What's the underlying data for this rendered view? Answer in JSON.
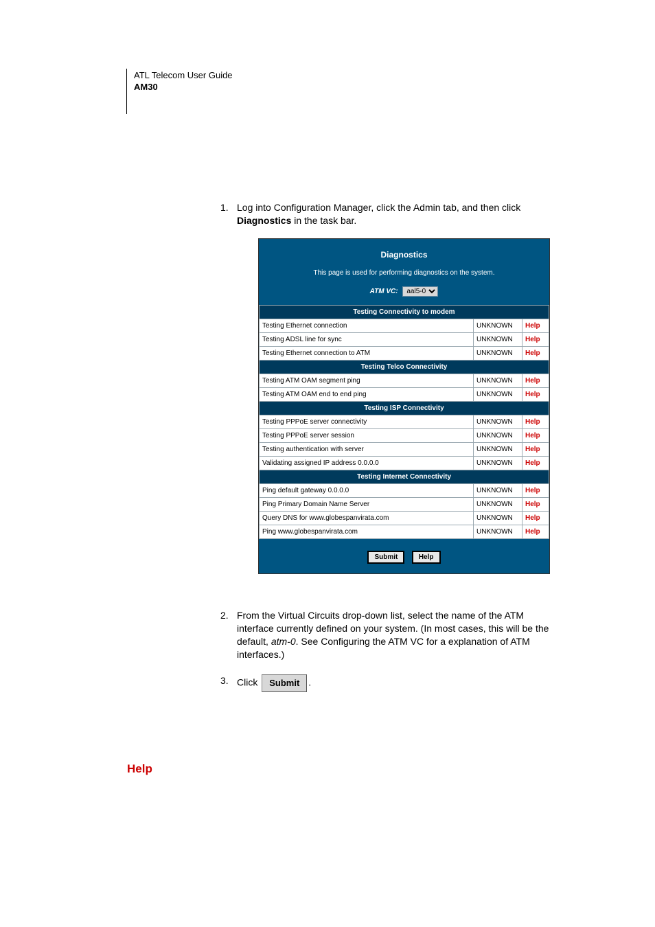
{
  "header": {
    "line1": "ATL Telecom User Guide",
    "line2": "AM30"
  },
  "steps": {
    "s1": {
      "num": "1.",
      "pre": "Log into Configuration Manager, click the Admin tab, and then click ",
      "bold": "Diagnostics",
      "post": " in the task bar."
    },
    "s2": {
      "num": "2.",
      "pre": "From the Virtual Circuits drop-down list, select the name of the ATM interface currently defined on your system. (In most cases, this will be the default, ",
      "italic": "atm-0",
      "post": ". See Configuring the ATM VC for a explanation of ATM interfaces.)"
    },
    "s3": {
      "num": "3.",
      "pre": "Click ",
      "btn": "Submit",
      "post": "."
    }
  },
  "panel": {
    "title": "Diagnostics",
    "desc": "This page is used for performing diagnostics on the system.",
    "atm_label": "ATM VC:",
    "atm_value": "aal5-0",
    "sections": [
      {
        "header": "Testing Connectivity to modem",
        "rows": [
          {
            "test": "Testing Ethernet connection",
            "status": "UNKNOWN",
            "help": "Help"
          },
          {
            "test": "Testing ADSL line for sync",
            "status": "UNKNOWN",
            "help": "Help"
          },
          {
            "test": "Testing Ethernet connection to ATM",
            "status": "UNKNOWN",
            "help": "Help"
          }
        ]
      },
      {
        "header": "Testing Telco Connectivity",
        "rows": [
          {
            "test": "Testing ATM OAM segment ping",
            "status": "UNKNOWN",
            "help": "Help"
          },
          {
            "test": "Testing ATM OAM end to end ping",
            "status": "UNKNOWN",
            "help": "Help"
          }
        ]
      },
      {
        "header": "Testing ISP Connectivity",
        "rows": [
          {
            "test": "Testing PPPoE server connectivity",
            "status": "UNKNOWN",
            "help": "Help"
          },
          {
            "test": "Testing PPPoE server session",
            "status": "UNKNOWN",
            "help": "Help"
          },
          {
            "test": "Testing authentication with server",
            "status": "UNKNOWN",
            "help": "Help"
          },
          {
            "test": "Validating assigned IP address 0.0.0.0",
            "status": "UNKNOWN",
            "help": "Help"
          }
        ]
      },
      {
        "header": "Testing Internet Connectivity",
        "rows": [
          {
            "test": "Ping default gateway 0.0.0.0",
            "status": "UNKNOWN",
            "help": "Help"
          },
          {
            "test": "Ping Primary Domain Name Server",
            "status": "UNKNOWN",
            "help": "Help"
          },
          {
            "test": "Query DNS for www.globespanvirata.com",
            "status": "UNKNOWN",
            "help": "Help"
          },
          {
            "test": "Ping www.globespanvirata.com",
            "status": "UNKNOWN",
            "help": "Help"
          }
        ]
      }
    ],
    "buttons": {
      "submit": "Submit",
      "help": "Help"
    }
  },
  "footer_heading": "Help"
}
